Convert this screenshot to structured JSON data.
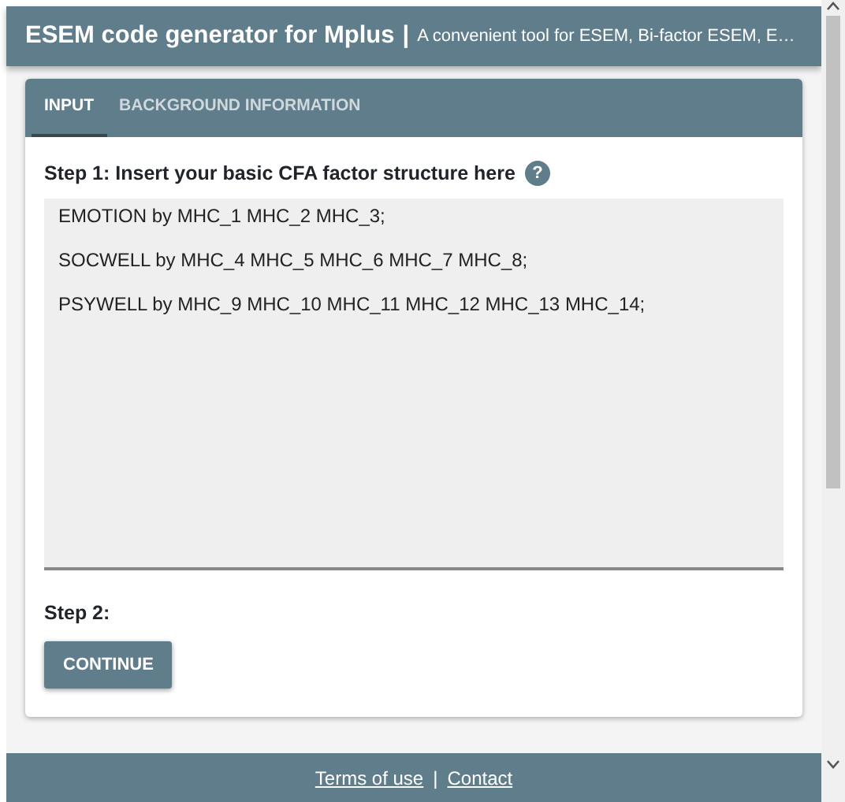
{
  "header": {
    "title": "ESEM code generator for Mplus",
    "separator": "|",
    "subtitle": "A convenient tool for ESEM, Bi-factor ESEM, E…"
  },
  "tabs": [
    {
      "label": "INPUT",
      "selected": true
    },
    {
      "label": "BACKGROUND INFORMATION",
      "selected": false
    }
  ],
  "step1": {
    "label": "Step 1: Insert your basic CFA factor structure here",
    "help_glyph": "?"
  },
  "factor_structure": [
    "EMOTION by MHC_1 MHC_2 MHC_3;",
    "SOCWELL by MHC_4 MHC_5 MHC_6 MHC_7 MHC_8;",
    "PSYWELL by MHC_9 MHC_10 MHC_11 MHC_12 MHC_13 MHC_14;"
  ],
  "step2": {
    "label": "Step 2:"
  },
  "buttons": [
    "CONTINUE"
  ],
  "footer": {
    "links": [
      "Terms of use",
      "Contact"
    ],
    "separator": "|"
  }
}
